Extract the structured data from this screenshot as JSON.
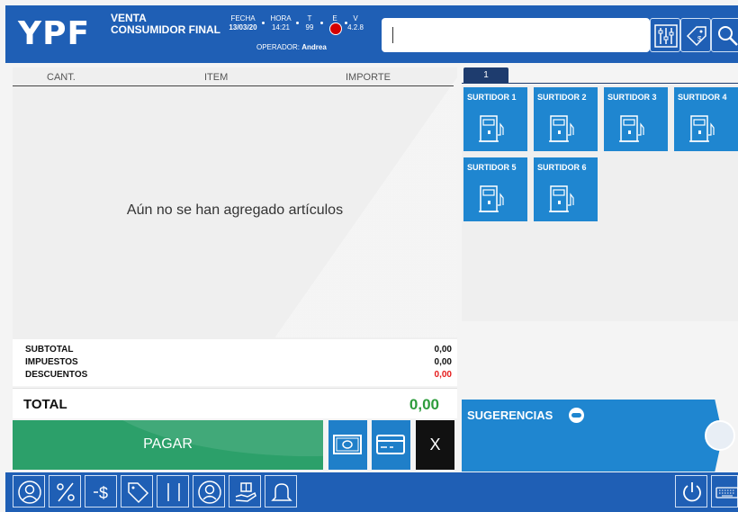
{
  "header": {
    "logo": "YPF",
    "sale_type_line1": "VENTA",
    "sale_type_line2": "CONSUMIDOR FINAL",
    "fecha_label": "FECHA",
    "fecha_value": "13/03/20",
    "hora_label": "HORA",
    "hora_value": "14:21",
    "t_label": "T",
    "t_value": "99",
    "e_label": "E",
    "v_label": "V",
    "v_value": "4.2.8",
    "operator_label": "OPERADOR:",
    "operator_name": "Andrea",
    "search_value": "",
    "buttons": [
      "settings-sliders-icon",
      "price-tag-icon",
      "search-icon"
    ]
  },
  "table": {
    "columns": [
      "CANT.",
      "ITEM",
      "IMPORTE"
    ],
    "empty_message": "Aún no se han agregado artículos"
  },
  "totals": {
    "subtotal_label": "SUBTOTAL",
    "subtotal_value": "0,00",
    "taxes_label": "IMPUESTOS",
    "taxes_value": "0,00",
    "discounts_label": "DESCUENTOS",
    "discounts_value": "0,00",
    "total_label": "TOTAL",
    "total_value": "0,00"
  },
  "actions": {
    "pay_label": "PAGAR",
    "cancel_label": "X",
    "cash_icon": "cash-icon",
    "card_icon": "card-icon"
  },
  "pumps": {
    "tab_label": "1",
    "items": [
      "SURTIDOR 1",
      "SURTIDOR 2",
      "SURTIDOR 3",
      "SURTIDOR 4",
      "SURTIDOR 5",
      "SURTIDOR 6"
    ]
  },
  "suggestions": {
    "label": "SUGERENCIAS"
  },
  "toolbar": {
    "icons": [
      "customer-icon",
      "percent-icon",
      "money-icon",
      "tag-icon",
      "barcode-icon",
      "attendant-icon",
      "gift-icon",
      "bell-icon",
      "power-icon",
      "keyboard-icon"
    ]
  },
  "colors": {
    "brand_blue": "#1f5fb5",
    "pump_blue": "#1f86d0",
    "pay_green": "#2ca06a",
    "total_green": "#2d9c3c",
    "discount_red": "#e51b1b",
    "status_red": "#d40000"
  }
}
